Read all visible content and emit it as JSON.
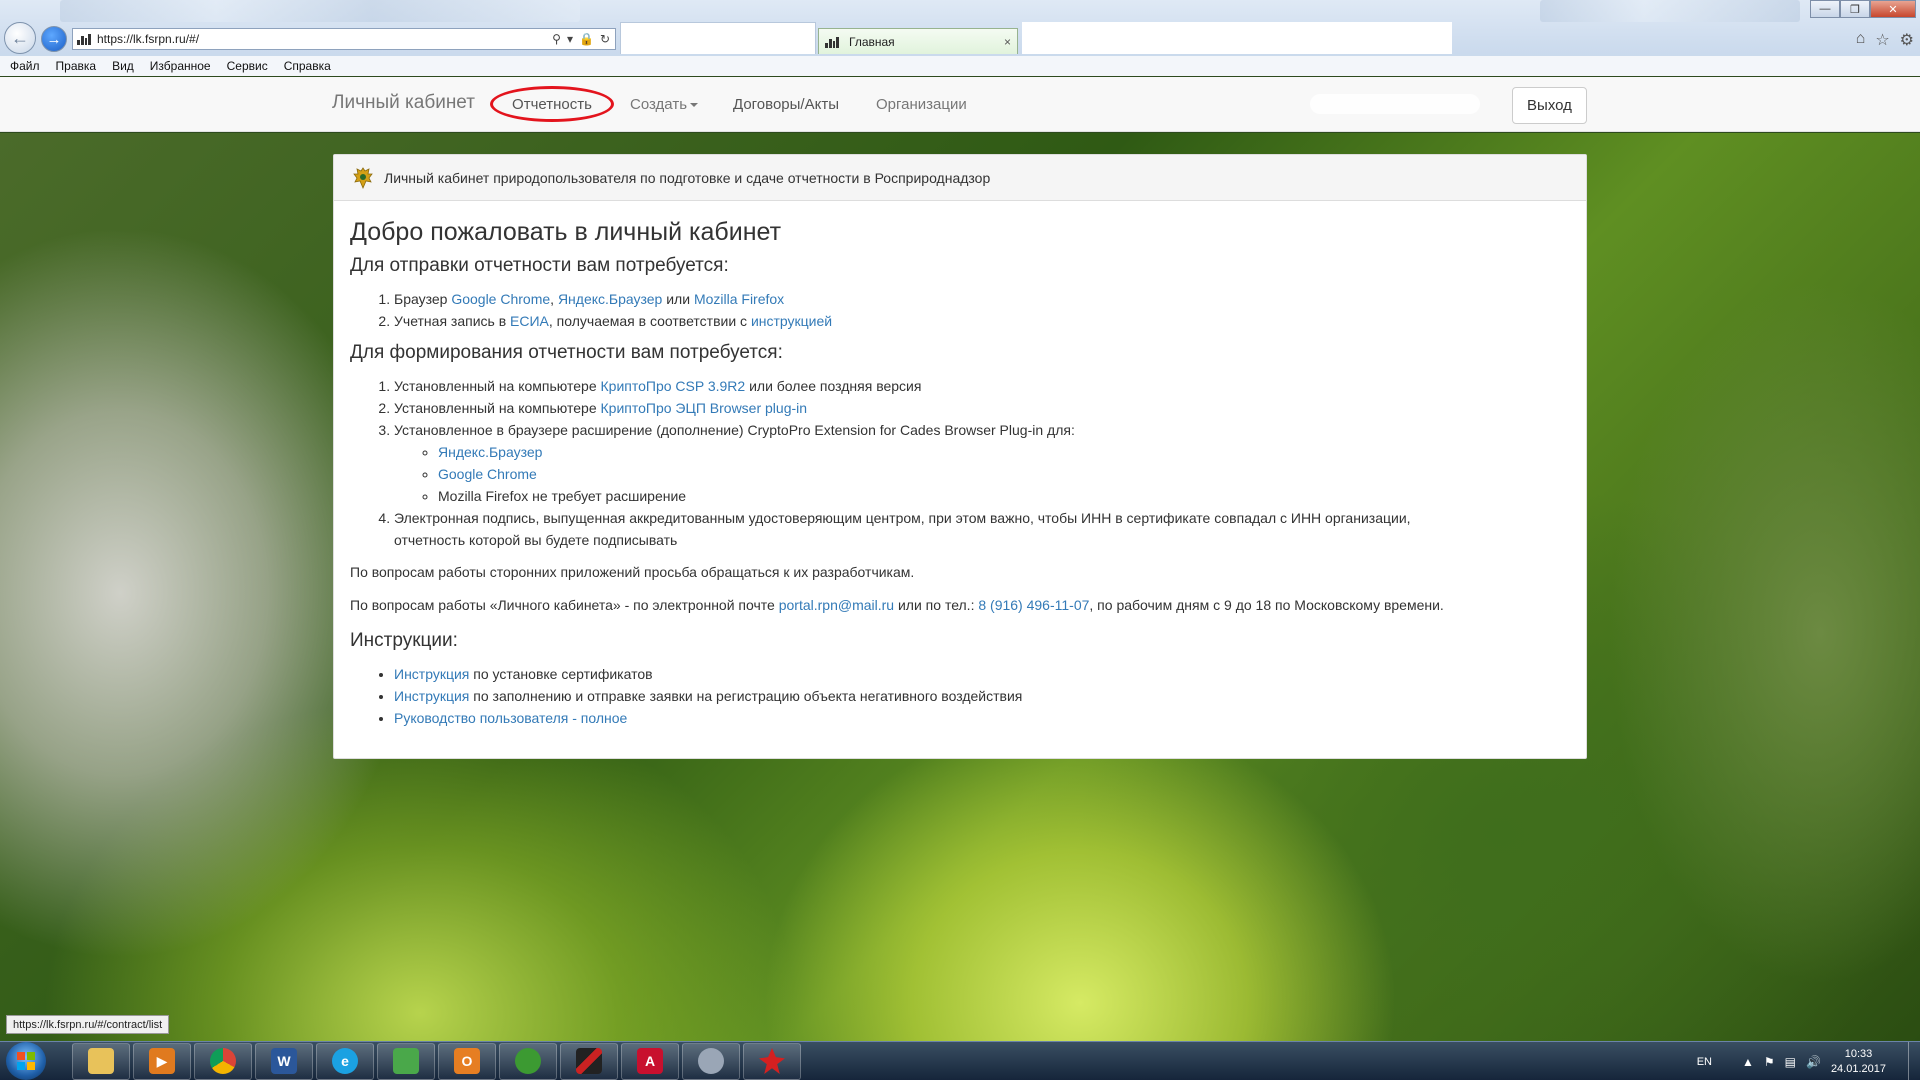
{
  "browser": {
    "url": "https://lk.fsrpn.ru/#/",
    "active_tab": "Главная",
    "tab_close": "×",
    "menu": [
      "Файл",
      "Правка",
      "Вид",
      "Избранное",
      "Сервис",
      "Справка"
    ]
  },
  "navbar": {
    "brand": "Личный кабинет",
    "report": "Отчетность",
    "create": "Создать",
    "contracts": "Договоры/Акты",
    "orgs": "Организации",
    "logout": "Выход"
  },
  "panel": {
    "heading": "Личный кабинет природопользователя по подготовке и сдаче отчетности в Росприроднадзор",
    "welcome": "Добро пожаловать в личный кабинет",
    "send_title": "Для отправки отчетности вам потребуется:",
    "send": {
      "browser_prefix": "Браузер ",
      "chrome": "Google Chrome",
      "comma": ", ",
      "yandex": "Яндекс.Браузер",
      "or": " или ",
      "firefox": "Mozilla Firefox",
      "account_prefix": "Учетная запись в ",
      "esia": "ЕСИА",
      "account_mid": ", получаемая в соответствии с ",
      "instruction": "инструкцией"
    },
    "form_title": "Для формирования отчетности вам потребуется:",
    "form": {
      "item1_prefix": "Установленный на компьютере ",
      "item1_link": "КриптоПро CSP 3.9R2",
      "item1_suffix": " или более поздняя версия",
      "item2_prefix": "Установленный на компьютере ",
      "item2_link": "КриптоПро ЭЦП Browser plug-in",
      "item3": "Установленное в браузере расширение (дополнение) CryptoPro Extension for Cades Browser Plug-in для:",
      "sub_yandex": "Яндекс.Браузер",
      "sub_chrome": "Google Chrome",
      "sub_firefox": "Mozilla Firefox не требует расширение",
      "item4_line1": "Электронная подпись, выпущенная аккредитованным удостоверяющим центром, при этом важно, чтобы ИНН в сертификате совпадал с ИНН организации,",
      "item4_line2": "отчетность которой вы будете подписывать"
    },
    "note1": "По вопросам работы сторонних приложений просьба обращаться к их разработчикам.",
    "note2": {
      "prefix": "По вопросам работы «Личного кабинета» - по электронной почте ",
      "email": "portal.rpn@mail.ru",
      "mid": " или по тел.: ",
      "phone": "8 (916) 496-11-07",
      "suffix": ", по рабочим дням с 9 до 18 по Московскому времени."
    },
    "instr_title": "Инструкции:",
    "instructions": {
      "i1_link": "Инструкция",
      "i1_text": " по установке сертификатов",
      "i2_link": "Инструкция",
      "i2_text": " по заполнению и отправке заявки на регистрацию объекта негативного воздействия",
      "i3_link": "Руководство пользователя - полное"
    }
  },
  "status_url": "https://lk.fsrpn.ru/#/contract/list",
  "taskbar": {
    "lang": "EN",
    "time": "10:33",
    "date": "24.01.2017"
  },
  "colors": {
    "link": "#337ab7",
    "highlight_circle": "#e3141d",
    "navbar_bg": "#f8f8f8"
  }
}
